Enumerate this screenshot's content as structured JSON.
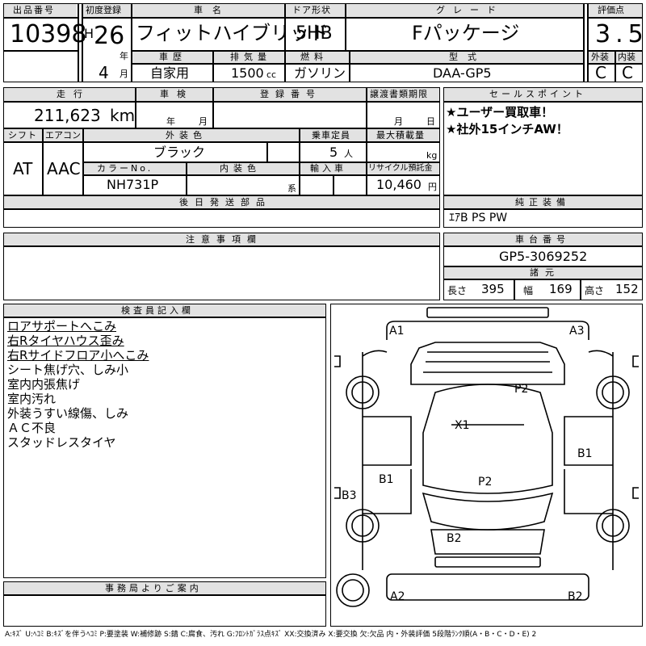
{
  "header": {
    "lot_label": "出品番号",
    "lot_no": "10398",
    "first_reg_label": "初度登録",
    "era": "H",
    "year": "26",
    "year_unit": "年",
    "month": "4",
    "month_unit": "月",
    "model_label": "車名",
    "model": "フィットハイブリッド",
    "door_label": "ドア形状",
    "door": "5HB",
    "grade_label": "グレード",
    "grade": "Fパッケージ",
    "score_label": "評価点",
    "score": "3.5",
    "history_label": "車歴",
    "history": "自家用",
    "disp_label": "排気量",
    "disp": "1500",
    "disp_unit": "cc",
    "fuel_label": "燃料",
    "fuel": "ガソリン",
    "type_label": "型式",
    "type": "DAA-GP5",
    "ext_label": "外装",
    "ext": "C",
    "int_label": "内装",
    "int": "C"
  },
  "row2": {
    "mileage_label": "走行",
    "mileage": "211,623",
    "mileage_unit": "km",
    "inspection_label": "車検",
    "insp_year": "年",
    "insp_month": "月",
    "plate_label": "登録番号",
    "transfer_label": "譲渡書類期限",
    "tr_month": "月",
    "tr_day": "日",
    "shift_label": "シフト",
    "shift": "AT",
    "ac_label": "エアコン",
    "ac": "AAC",
    "color_label": "外装色",
    "color": "ブラック",
    "seats_label": "乗車定員",
    "seats": "5",
    "seats_unit": "人",
    "load_label": "最大積載量",
    "load_unit": "kg",
    "colorno_label": "カラーNo.",
    "colorno": "NH731P",
    "intcolor_label": "内装色",
    "intcolor_unit": "系",
    "import_label": "輸入車",
    "recycle_label": "リサイクル預託金",
    "recycle": "10,460",
    "recycle_unit": "円"
  },
  "sales": {
    "label": "セールスポイント",
    "items": [
      "★ユーザー買取車！",
      "★社外15インチAW！"
    ]
  },
  "later_parts_label": "後日発送部品",
  "equipment": {
    "label": "純正装備",
    "value": "ｴｱB PS PW"
  },
  "caution_label": "注意事項欄",
  "chassis": {
    "label": "車台番号",
    "value": "GP5-3069252"
  },
  "dims": {
    "label": "諸元",
    "len_label": "長さ",
    "len": "395",
    "wid_label": "幅",
    "wid": "169",
    "hgt_label": "高さ",
    "hgt": "152"
  },
  "inspector": {
    "label": "検査員記入欄",
    "notes": [
      {
        "text": "ロアサポートへこみ",
        "underline": true
      },
      {
        "text": "右Rタイヤハウス歪み",
        "underline": true
      },
      {
        "text": "右Rサイドフロア小へこみ",
        "underline": true
      },
      {
        "text": "シート焦げ穴、しみ小",
        "underline": false
      },
      {
        "text": "室内内張焦げ",
        "underline": false
      },
      {
        "text": "室内汚れ",
        "underline": false
      },
      {
        "text": "外装うすい線傷、しみ",
        "underline": false
      },
      {
        "text": "ＡＣ不良",
        "underline": false
      },
      {
        "text": "スタッドレスタイヤ",
        "underline": false
      }
    ]
  },
  "diagram": {
    "marks": [
      {
        "id": "a1",
        "text": "A1"
      },
      {
        "id": "a3",
        "text": "A3"
      },
      {
        "id": "p2-top",
        "text": "P2"
      },
      {
        "id": "x1",
        "text": "X1"
      },
      {
        "id": "b1-right",
        "text": "B1"
      },
      {
        "id": "b1-left",
        "text": "B1"
      },
      {
        "id": "p2-mid",
        "text": "P2"
      },
      {
        "id": "b3",
        "text": "B3"
      },
      {
        "id": "b2-mid",
        "text": "B2"
      },
      {
        "id": "a2",
        "text": "A2"
      },
      {
        "id": "b2-bottom",
        "text": "B2"
      }
    ]
  },
  "office_label": "事務局よりご案内",
  "legend": "A:ｷｽﾞ U:ﾍｺﾐ B:ｷｽﾞを伴うﾍｺﾐ P:要塗装 W:補修跡 S:錆 C:腐食、汚れ G:ﾌﾛﾝﾄｶﾞﾗｽ点ｷｽﾞ XX:交換済み X:要交換 欠:欠品 内・外装評価 5段階ﾗﾝｸ順(A・B・C・D・E) 2"
}
